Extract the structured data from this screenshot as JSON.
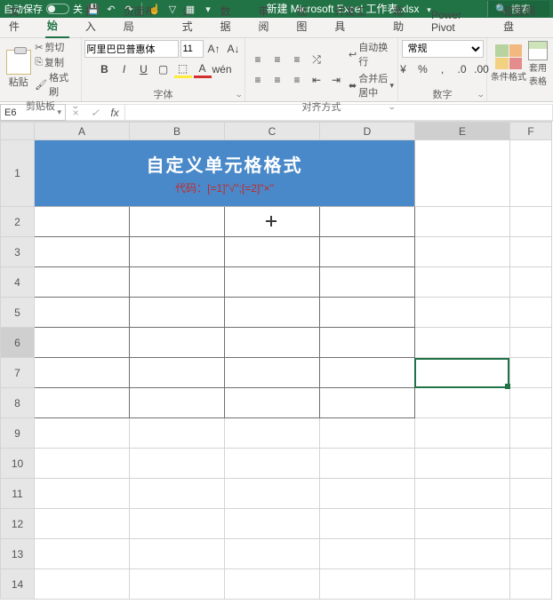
{
  "title_bar": {
    "autosave_label": "自动保存",
    "autosave_state": "关",
    "filename": "新建 Microsoft Excel 工作表.xlsx",
    "search_label": "搜索"
  },
  "tabs": {
    "file": "文件",
    "home": "开始",
    "insert": "插入",
    "page_layout": "页面布局",
    "formulas": "公式",
    "data": "数据",
    "review": "审阅",
    "view": "视图",
    "developer": "开发工具",
    "help": "帮助",
    "powerpivot": "Power Pivot",
    "baidu": "百度网盘"
  },
  "ribbon": {
    "clipboard": {
      "paste": "粘贴",
      "cut": "剪切",
      "copy": "复制",
      "format_painter": "格式刷",
      "label": "剪贴板"
    },
    "font": {
      "font_name": "阿里巴巴普惠体",
      "font_size": "11",
      "label": "字体"
    },
    "alignment": {
      "wrap": "自动换行",
      "merge": "合并后居中",
      "label": "对齐方式"
    },
    "number": {
      "format": "常规",
      "label": "数字"
    },
    "styles": {
      "cond_fmt": "条件格式",
      "cell_style": "套用表格"
    }
  },
  "namebox": {
    "ref": "E6"
  },
  "sheet": {
    "columns": [
      "A",
      "B",
      "C",
      "D",
      "E",
      "F"
    ],
    "rows": [
      "1",
      "2",
      "3",
      "4",
      "5",
      "6",
      "7",
      "8",
      "9",
      "10",
      "11",
      "12",
      "13",
      "14"
    ],
    "banner_title": "自定义单元格格式",
    "banner_code_label": "代码：",
    "banner_code_value": "[=1]\"√\";[=2]\"×\""
  },
  "colors": {
    "brand": "#217346",
    "banner": "#4a89c9",
    "code_text": "#c62828"
  }
}
